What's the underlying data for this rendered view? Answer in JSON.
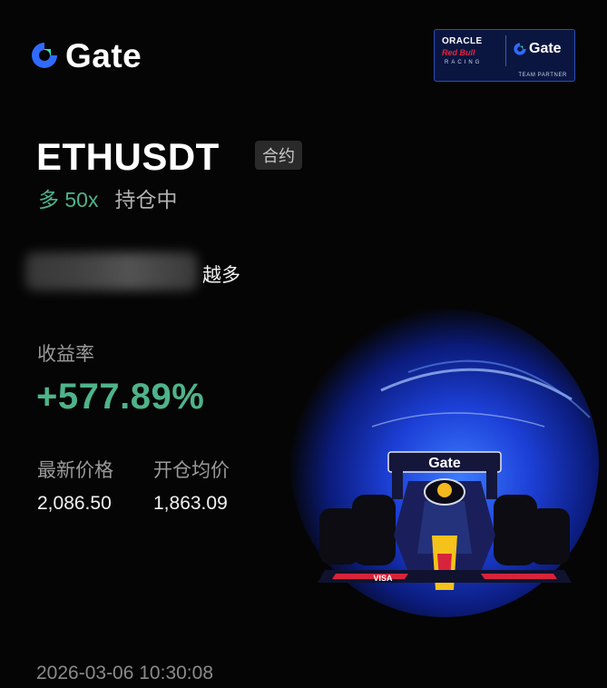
{
  "brand": {
    "logo_text": "Gate",
    "accent_color": "#2f6bff"
  },
  "partner_badge": {
    "line1": "ORACLE",
    "line2": "Red Bull",
    "line3": "RACING",
    "gate_text": "Gate",
    "footer": "TEAM PARTNER"
  },
  "position": {
    "symbol": "ETHUSDT",
    "type_tag": "合约",
    "direction_leverage": "多 50x",
    "status": "持仓中"
  },
  "slogan": {
    "visible_text": "越多"
  },
  "yield": {
    "label": "收益率",
    "value": "+577.89%",
    "color": "#4fb38a"
  },
  "prices": {
    "latest_label": "最新价格",
    "latest_value": "2,086.50",
    "entry_label": "开仓均价",
    "entry_value": "1,863.09"
  },
  "timestamp": "2026-03-06 10:30:08",
  "hero": {
    "wing_text": "Gate",
    "sponsor_text": "VISA"
  }
}
